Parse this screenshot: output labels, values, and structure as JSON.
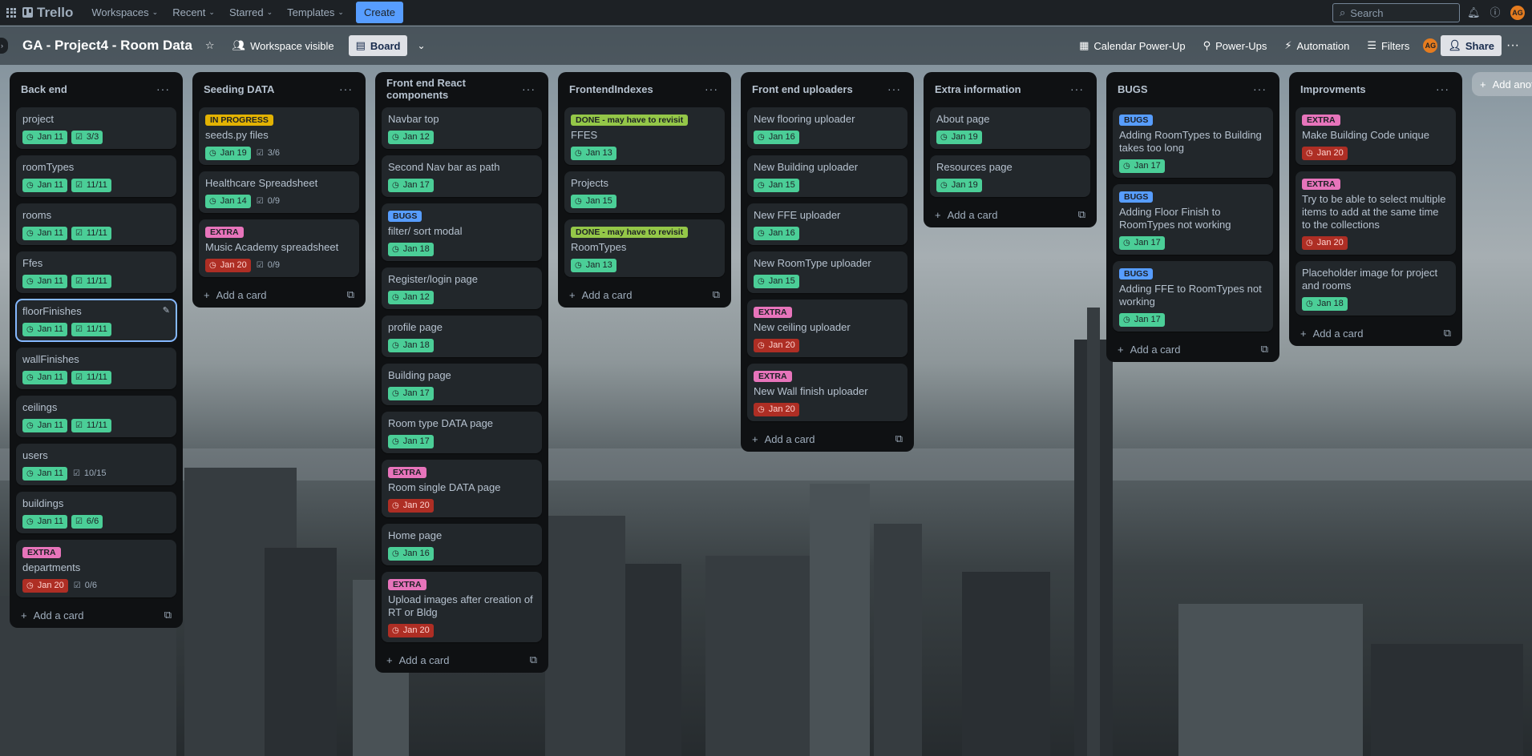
{
  "topnav": {
    "logo_text": "Trello",
    "menus": [
      "Workspaces",
      "Recent",
      "Starred",
      "Templates"
    ],
    "create_label": "Create",
    "search_placeholder": "Search",
    "avatar_initials": "AG"
  },
  "boardbar": {
    "title": "GA - Project4 - Room Data",
    "visibility": "Workspace visible",
    "view_label": "Board",
    "right_items": [
      "Calendar Power-Up",
      "Power-Ups",
      "Automation",
      "Filters"
    ],
    "avatar_initials": "AG",
    "share_label": "Share"
  },
  "add_card_label": "Add a card",
  "add_another_label": "Add anot",
  "colors": {
    "accent_blue": "#579dff",
    "label_in_progress": "#e2b203",
    "label_extra": "#e774bb",
    "label_bugs": "#579dff",
    "label_done": "#94c748",
    "date_green": "#4bce97",
    "date_overdue": "#ae2e24"
  },
  "lists": [
    {
      "title": "Back end",
      "cards": [
        {
          "title": "project",
          "date": "Jan 11",
          "date_status": "green",
          "checklist": "3/3",
          "check_status": "green"
        },
        {
          "title": "roomTypes",
          "date": "Jan 11",
          "date_status": "green",
          "checklist": "11/11",
          "check_status": "green"
        },
        {
          "title": "rooms",
          "date": "Jan 11",
          "date_status": "green",
          "checklist": "11/11",
          "check_status": "green"
        },
        {
          "title": "Ffes",
          "date": "Jan 11",
          "date_status": "green",
          "checklist": "11/11",
          "check_status": "green"
        },
        {
          "title": "floorFinishes",
          "date": "Jan 11",
          "date_status": "green",
          "checklist": "11/11",
          "check_status": "green",
          "selected": true
        },
        {
          "title": "wallFinishes",
          "date": "Jan 11",
          "date_status": "green",
          "checklist": "11/11",
          "check_status": "green"
        },
        {
          "title": "ceilings",
          "date": "Jan 11",
          "date_status": "green",
          "checklist": "11/11",
          "check_status": "green"
        },
        {
          "title": "users",
          "date": "Jan 11",
          "date_status": "green",
          "checklist": "10/15",
          "check_status": "plain"
        },
        {
          "title": "buildings",
          "date": "Jan 11",
          "date_status": "green",
          "checklist": "6/6",
          "check_status": "green"
        },
        {
          "label": "EXTRA",
          "label_kind": "extra",
          "title": "departments",
          "date": "Jan 20",
          "date_status": "red",
          "checklist": "0/6",
          "check_status": "plain"
        }
      ]
    },
    {
      "title": "Seeding DATA",
      "cards": [
        {
          "label": "IN PROGRESS",
          "label_kind": "inprogress",
          "title": "seeds.py files",
          "date": "Jan 19",
          "date_status": "green",
          "checklist": "3/6",
          "check_status": "plain"
        },
        {
          "title": "Healthcare Spreadsheet",
          "date": "Jan 14",
          "date_status": "green",
          "checklist": "0/9",
          "check_status": "plain"
        },
        {
          "label": "EXTRA",
          "label_kind": "extra",
          "title": "Music Academy spreadsheet",
          "date": "Jan 20",
          "date_status": "red",
          "checklist": "0/9",
          "check_status": "plain"
        }
      ]
    },
    {
      "title": "Front end React components",
      "cards": [
        {
          "title": "Navbar top",
          "date": "Jan 12",
          "date_status": "green"
        },
        {
          "title": "Second Nav bar as path",
          "date": "Jan 17",
          "date_status": "green"
        },
        {
          "label": "BUGS",
          "label_kind": "bugs",
          "title": "filter/ sort modal",
          "date": "Jan 18",
          "date_status": "green"
        },
        {
          "title": "Register/login page",
          "date": "Jan 12",
          "date_status": "green"
        },
        {
          "title": "profile page",
          "date": "Jan 18",
          "date_status": "green"
        },
        {
          "title": "Building page",
          "date": "Jan 17",
          "date_status": "green"
        },
        {
          "title": "Room type DATA page",
          "date": "Jan 17",
          "date_status": "green"
        },
        {
          "label": "EXTRA",
          "label_kind": "extra",
          "title": "Room single DATA page",
          "date": "Jan 20",
          "date_status": "red"
        },
        {
          "title": "Home page",
          "date": "Jan 16",
          "date_status": "green"
        },
        {
          "label": "EXTRA",
          "label_kind": "extra",
          "title": "Upload images after creation of RT or Bldg",
          "date": "Jan 20",
          "date_status": "red"
        }
      ]
    },
    {
      "title": "FrontendIndexes",
      "cards": [
        {
          "label": "DONE - may have to revisit",
          "label_kind": "done",
          "title": "FFES",
          "date": "Jan 13",
          "date_status": "green"
        },
        {
          "title": "Projects",
          "date": "Jan 15",
          "date_status": "green"
        },
        {
          "label": "DONE - may have to revisit",
          "label_kind": "done",
          "title": "RoomTypes",
          "date": "Jan 13",
          "date_status": "green"
        }
      ]
    },
    {
      "title": "Front end uploaders",
      "cards": [
        {
          "title": "New flooring uploader",
          "date": "Jan 16",
          "date_status": "green"
        },
        {
          "title": "New Building uploader",
          "date": "Jan 15",
          "date_status": "green"
        },
        {
          "title": "New FFE uploader",
          "date": "Jan 16",
          "date_status": "green"
        },
        {
          "title": "New RoomType uploader",
          "date": "Jan 15",
          "date_status": "green"
        },
        {
          "label": "EXTRA",
          "label_kind": "extra",
          "title": "New ceiling uploader",
          "date": "Jan 20",
          "date_status": "red"
        },
        {
          "label": "EXTRA",
          "label_kind": "extra",
          "title": "New Wall finish uploader",
          "date": "Jan 20",
          "date_status": "red"
        }
      ]
    },
    {
      "title": "Extra information",
      "cards": [
        {
          "title": "About page",
          "date": "Jan 19",
          "date_status": "green"
        },
        {
          "title": "Resources page",
          "date": "Jan 19",
          "date_status": "green"
        }
      ]
    },
    {
      "title": "BUGS",
      "cards": [
        {
          "label": "BUGS",
          "label_kind": "bugs",
          "title": "Adding RoomTypes to Building takes too long",
          "date": "Jan 17",
          "date_status": "green"
        },
        {
          "label": "BUGS",
          "label_kind": "bugs",
          "title": "Adding Floor Finish to RoomTypes not working",
          "date": "Jan 17",
          "date_status": "green"
        },
        {
          "label": "BUGS",
          "label_kind": "bugs",
          "title": "Adding FFE to RoomTypes not working",
          "date": "Jan 17",
          "date_status": "green"
        }
      ]
    },
    {
      "title": "Improvments",
      "cards": [
        {
          "label": "EXTRA",
          "label_kind": "extra",
          "title": "Make Building Code unique",
          "date": "Jan 20",
          "date_status": "red"
        },
        {
          "label": "EXTRA",
          "label_kind": "extra",
          "title": "Try to be able to select multiple items to add at the same time to the collections",
          "date": "Jan 20",
          "date_status": "red"
        },
        {
          "title": "Placeholder image for project and rooms",
          "date": "Jan 18",
          "date_status": "green"
        }
      ]
    }
  ]
}
